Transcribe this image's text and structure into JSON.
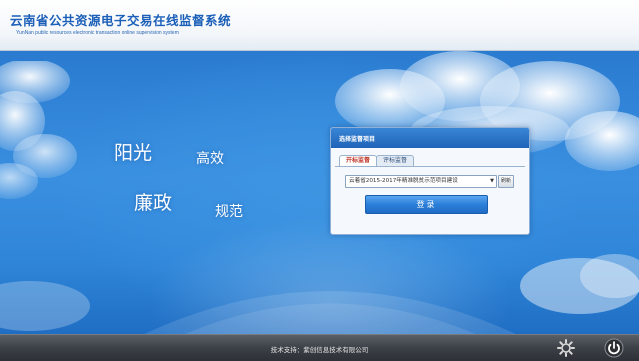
{
  "header": {
    "title": "云南省公共资源电子交易在线监督系统",
    "subtitle": "YunNan public resources electronic transaction online supervision system"
  },
  "slogans": {
    "sunshine": "阳光",
    "efficiency": "高效",
    "integrity": "廉政",
    "standard": "规范"
  },
  "login_panel": {
    "title": "选择监督项目",
    "tabs": [
      {
        "label": "开标监督",
        "active": true
      },
      {
        "label": "评标监督",
        "active": false
      }
    ],
    "project_select": {
      "value": "云着省2015-2017年精准脱贫示范项目建设"
    },
    "refresh_label": "刷新",
    "login_label": "登录"
  },
  "footer": {
    "support_text": "技术支持：紫创信息技术有限公司",
    "icons": [
      "settings-icon",
      "power-icon"
    ]
  },
  "colors": {
    "title_blue": "#1b5fb8",
    "sky_blue": "#2f85d8",
    "button_blue": "#2c7fd8",
    "active_tab_red": "#c0392b",
    "footer_gray": "#3c4047"
  }
}
